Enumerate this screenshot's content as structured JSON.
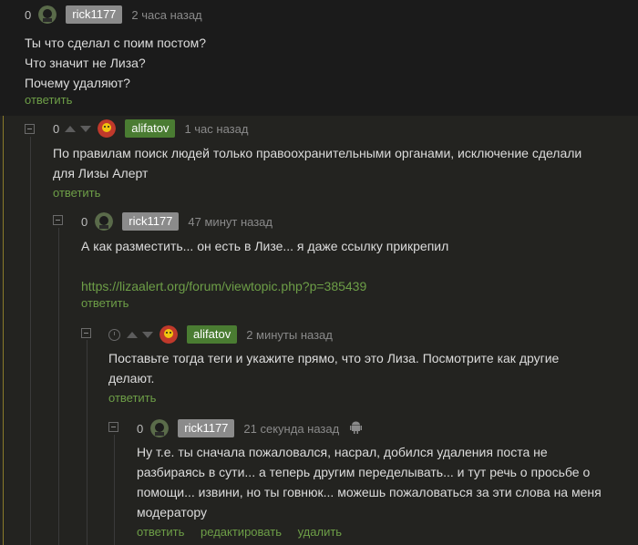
{
  "comments": [
    {
      "rating": "0",
      "author": "rick1177",
      "time": "2 часа назад",
      "lines": [
        "Ты что сделал с поим постом?",
        "Что значит не Лиза?",
        "Почему удаляют?"
      ],
      "actions": [
        "ответить"
      ]
    },
    {
      "rating": "0",
      "author": "alifatov",
      "time": "1 час назад",
      "lines": [
        "По правилам поиск людей только правоохранительными органами, исключение сделали",
        "для Лизы Алерт"
      ],
      "actions": [
        "ответить"
      ]
    },
    {
      "rating": "0",
      "author": "rick1177",
      "time": "47 минут назад",
      "lines": [
        "А как разместить... он есть в Лизе... я даже ссылку прикрепил"
      ],
      "link": "https://lizaalert.org/forum/viewtopic.php?p=385439",
      "actions": [
        "ответить"
      ]
    },
    {
      "author": "alifatov",
      "time": "2 минуты назад",
      "lines": [
        "Поставьте тогда теги и укажите прямо, что это Лиза. Посмотрите как другие",
        "делают."
      ],
      "actions": [
        "ответить"
      ]
    },
    {
      "rating": "0",
      "author": "rick1177",
      "time": "21 секунда назад",
      "lines": [
        "Ну т.е. ты сначала пожаловался, насрал, добился удаления поста не",
        "разбираясь в сути... а теперь другим переделывать... и тут речь о просьбе о",
        "помощи... извини, но ты говнюк... можешь пожаловаться за эти слова на меня",
        "модератору"
      ],
      "actions": [
        "ответить",
        "редактировать",
        "удалить"
      ]
    }
  ],
  "colors": {
    "background": "#1b1b1b",
    "highlight": "#252521",
    "nick_gray": "#8b8b8b",
    "nick_green": "#4a7c32",
    "link": "#6d9e47"
  }
}
